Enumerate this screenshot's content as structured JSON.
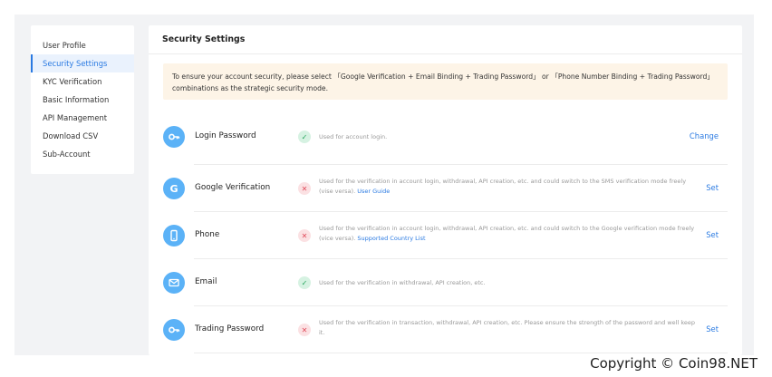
{
  "sidebar": {
    "items": [
      {
        "label": "User Profile"
      },
      {
        "label": "Security Settings"
      },
      {
        "label": "KYC Verification"
      },
      {
        "label": "Basic Information"
      },
      {
        "label": "API Management"
      },
      {
        "label": "Download CSV"
      },
      {
        "label": "Sub-Account"
      }
    ]
  },
  "main": {
    "title": "Security Settings",
    "notice": "To ensure your account security, please select 「Google Verification + Email Binding + Trading Password」 or 「Phone Number Binding + Trading Password」 combinations as the strategic security mode.",
    "rows": [
      {
        "icon": "key-icon",
        "title": "Login Password",
        "status": "enabled",
        "description": "Used for account login.",
        "link": "",
        "action": "Change"
      },
      {
        "icon": "google-icon",
        "title": "Google Verification",
        "status": "disabled",
        "description": "Used for the verification in account login, withdrawal, API creation, etc. and could switch to the SMS verification mode freely (vise versa).",
        "link": "User Guide",
        "action": "Set"
      },
      {
        "icon": "phone-icon",
        "title": "Phone",
        "status": "disabled",
        "description": "Used for the verification in account login, withdrawal, API creation, etc. and could switch to the Google verification mode freely (vice versa).",
        "link": "Supported Country List",
        "action": "Set"
      },
      {
        "icon": "mail-icon",
        "title": "Email",
        "status": "enabled",
        "description": "Used for the verification in withdrawal, API creation, etc.",
        "link": "",
        "action": ""
      },
      {
        "icon": "key-icon",
        "title": "Trading Password",
        "status": "disabled",
        "description": "Used for the verification in transaction, withdrawal, API creation, etc. Please ensure the strength of the password and well keep it.",
        "link": "",
        "action": "Set"
      }
    ]
  },
  "colors": {
    "accent": "#2a7ae2",
    "icon_bg": "#5bb2f7",
    "notice_bg": "#fdf4e7",
    "ok": "#22a35a",
    "bad": "#e04a5a"
  },
  "watermark": "Copyright © Coin98.NET"
}
